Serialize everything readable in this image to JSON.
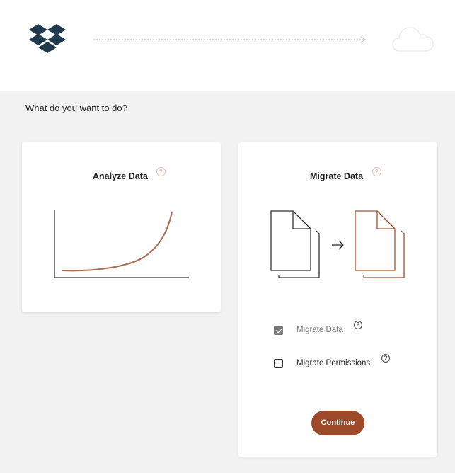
{
  "header": {
    "source_icon": "dropbox-logo-icon",
    "arrow_icon": "dotted-arrow-icon",
    "destination_icon": "cloud-icon"
  },
  "prompt": "What do you want to do?",
  "cards": {
    "analyze": {
      "title": "Analyze Data",
      "help_icon": "question-circle-icon",
      "illustration_icon": "growth-curve-chart-icon"
    },
    "migrate": {
      "title": "Migrate Data",
      "help_icon": "question-circle-icon",
      "illustration_icon": "document-transfer-icon",
      "options": [
        {
          "label": "Migrate Data",
          "checked": true,
          "disabled": true
        },
        {
          "label": "Migrate Permissions",
          "checked": false,
          "disabled": false
        }
      ],
      "continue_label": "Continue"
    }
  },
  "colors": {
    "accent": "#9e4a2a",
    "curve": "#a86b55",
    "logo": "#1f3a4c",
    "background": "#f2f2f2"
  }
}
